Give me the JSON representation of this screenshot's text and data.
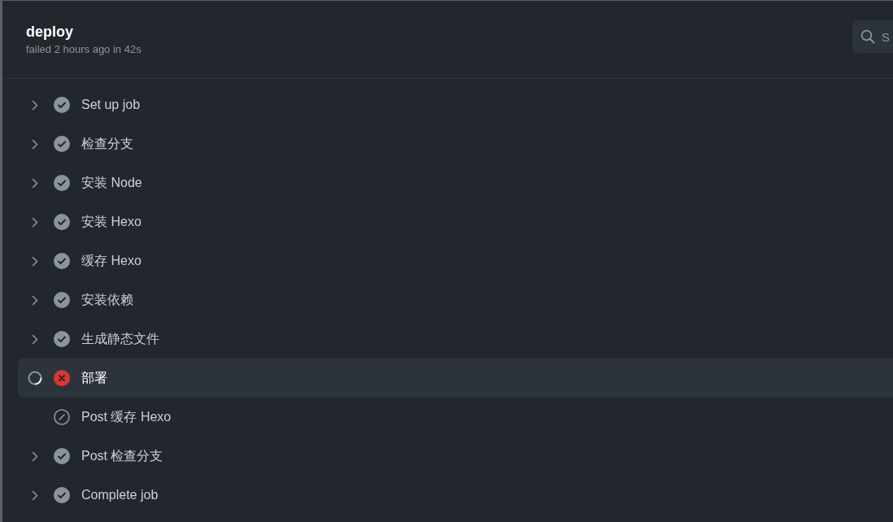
{
  "job": {
    "title": "deploy",
    "subtitle": "failed 2 hours ago in 42s"
  },
  "search": {
    "placeholder": "S"
  },
  "steps": [
    {
      "label": "Set up job",
      "kind": "success",
      "loading": false,
      "selected": false
    },
    {
      "label": "检查分支",
      "kind": "success",
      "loading": false,
      "selected": false
    },
    {
      "label": "安装 Node",
      "kind": "success",
      "loading": false,
      "selected": false
    },
    {
      "label": "安装 Hexo",
      "kind": "success",
      "loading": false,
      "selected": false
    },
    {
      "label": "缓存 Hexo",
      "kind": "success",
      "loading": false,
      "selected": false
    },
    {
      "label": "安装依赖",
      "kind": "success",
      "loading": false,
      "selected": false
    },
    {
      "label": "生成静态文件",
      "kind": "success",
      "loading": false,
      "selected": false
    },
    {
      "label": "部署",
      "kind": "failure",
      "loading": true,
      "selected": true
    },
    {
      "label": "Post 缓存 Hexo",
      "kind": "skipped",
      "loading": false,
      "selected": false
    },
    {
      "label": "Post 检查分支",
      "kind": "success",
      "loading": false,
      "selected": false
    },
    {
      "label": "Complete job",
      "kind": "success",
      "loading": false,
      "selected": false
    }
  ]
}
